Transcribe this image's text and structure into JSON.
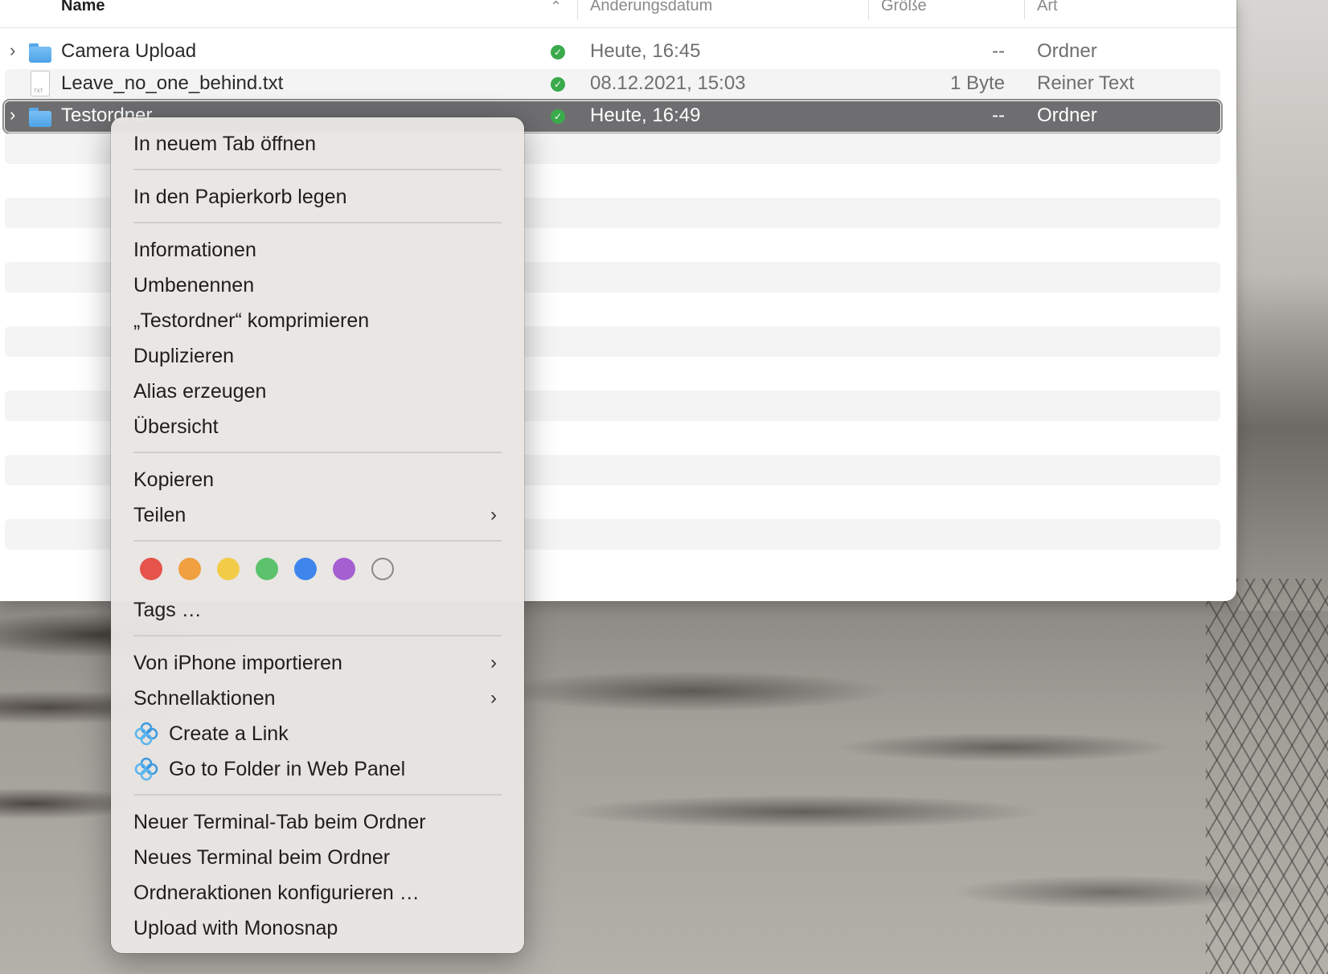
{
  "columns": {
    "name": "Name",
    "date": "Änderungsdatum",
    "size": "Größe",
    "kind": "Art"
  },
  "files": [
    {
      "name": "Camera Upload",
      "date": "Heute, 16:45",
      "size": "--",
      "kind": "Ordner",
      "type": "folder-icon"
    },
    {
      "name": "Leave_no_one_behind.txt",
      "date": "08.12.2021, 15:03",
      "size": "1 Byte",
      "kind": "Reiner Text",
      "type": "text-file-icon"
    },
    {
      "name": "Testordner",
      "date": "Heute, 16:49",
      "size": "--",
      "kind": "Ordner",
      "type": "folder-icon",
      "selected": true
    }
  ],
  "menu": {
    "open_tab": "In neuem Tab öffnen",
    "trash": "In den Papierkorb legen",
    "info": "Informationen",
    "rename": "Umbenennen",
    "compress": "„Testordner“ komprimieren",
    "duplicate": "Duplizieren",
    "alias": "Alias erzeugen",
    "quicklook": "Übersicht",
    "copy": "Kopieren",
    "share": "Teilen",
    "tags": "Tags …",
    "import_iphone": "Von iPhone importieren",
    "quick_actions": "Schnellaktionen",
    "create_link": "Create a Link",
    "web_panel": "Go to Folder in Web Panel",
    "terminal_tab": "Neuer Terminal-Tab beim Ordner",
    "terminal_new": "Neues Terminal beim Ordner",
    "folder_actions": "Ordneraktionen konfigurieren …",
    "monosnap": "Upload with Monosnap"
  },
  "tag_colors": [
    "#e5534b",
    "#f0a040",
    "#f2cc48",
    "#5cc26b",
    "#3f86ec",
    "#a45fd0",
    "none"
  ]
}
